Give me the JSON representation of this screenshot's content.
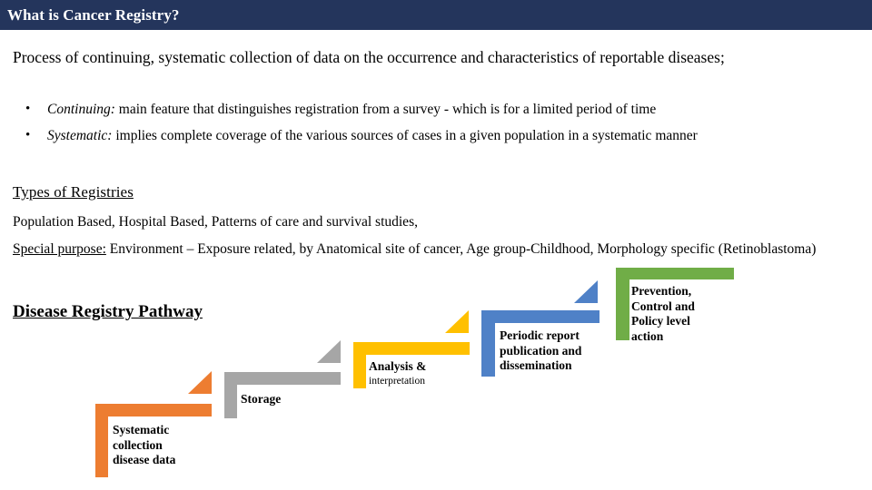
{
  "slide": {
    "title": "What is Cancer Registry?",
    "title_bar_color": "#24355C",
    "background": "#FFFFFF"
  },
  "content": {
    "intro": "Process of continuing, systematic collection of data on the  occurrence and characteristics of reportable diseases;",
    "bullets": [
      {
        "marker": "•",
        "lead": "Continuing:",
        "text": " main feature that distinguishes registration from a survey - which is for a  limited period of time"
      },
      {
        "marker": "•",
        "lead": "Systematic:",
        "text": " implies complete coverage of the  various sources of cases in a given  population  in a systematic manner"
      }
    ],
    "section_heading": "Types of Registries",
    "paragraph_1": "Population Based, Hospital Based, Patterns of care and survival studies,",
    "paragraph_2_lead": "Special purpose:",
    "paragraph_2": " Environment – Exposure related, by Anatomical site of cancer, Age group-Childhood, Morphology specific (Retinoblastoma)"
  },
  "diagram": {
    "heading": "Disease Registry Pathway",
    "steps": [
      {
        "id": "systematic-collection",
        "color": "#ED7D31",
        "label_main": "Systematic\ncollection\ndisease data",
        "label_line1": "Systematic",
        "label_line2": "collection",
        "label_line3": "disease data",
        "label_sub": "",
        "has_arrow": true
      },
      {
        "id": "storage",
        "color": "#A6A6A6",
        "label_main": "Storage",
        "label_line1": "Storage",
        "label_line2": "",
        "label_line3": "",
        "label_sub": "",
        "has_arrow": true
      },
      {
        "id": "analysis-interpretation",
        "color": "#FFC000",
        "label_main": "Analysis &",
        "label_line1": "Analysis &",
        "label_line2": "",
        "label_line3": "",
        "label_sub": "interpretation",
        "has_arrow": true
      },
      {
        "id": "periodic-report",
        "color": "#4F81C7",
        "label_main": "Periodic report",
        "label_line1": "Periodic report",
        "label_line2": "publication and",
        "label_line3": "dissemination",
        "label_sub": "",
        "has_arrow": true
      },
      {
        "id": "prevention-control",
        "color": "#70AD47",
        "label_main": "Prevention,",
        "label_line1": "Prevention,",
        "label_line2": "Control and",
        "label_line3": "Policy level",
        "label_line4": "action",
        "label_sub": "",
        "has_arrow": false
      }
    ]
  }
}
